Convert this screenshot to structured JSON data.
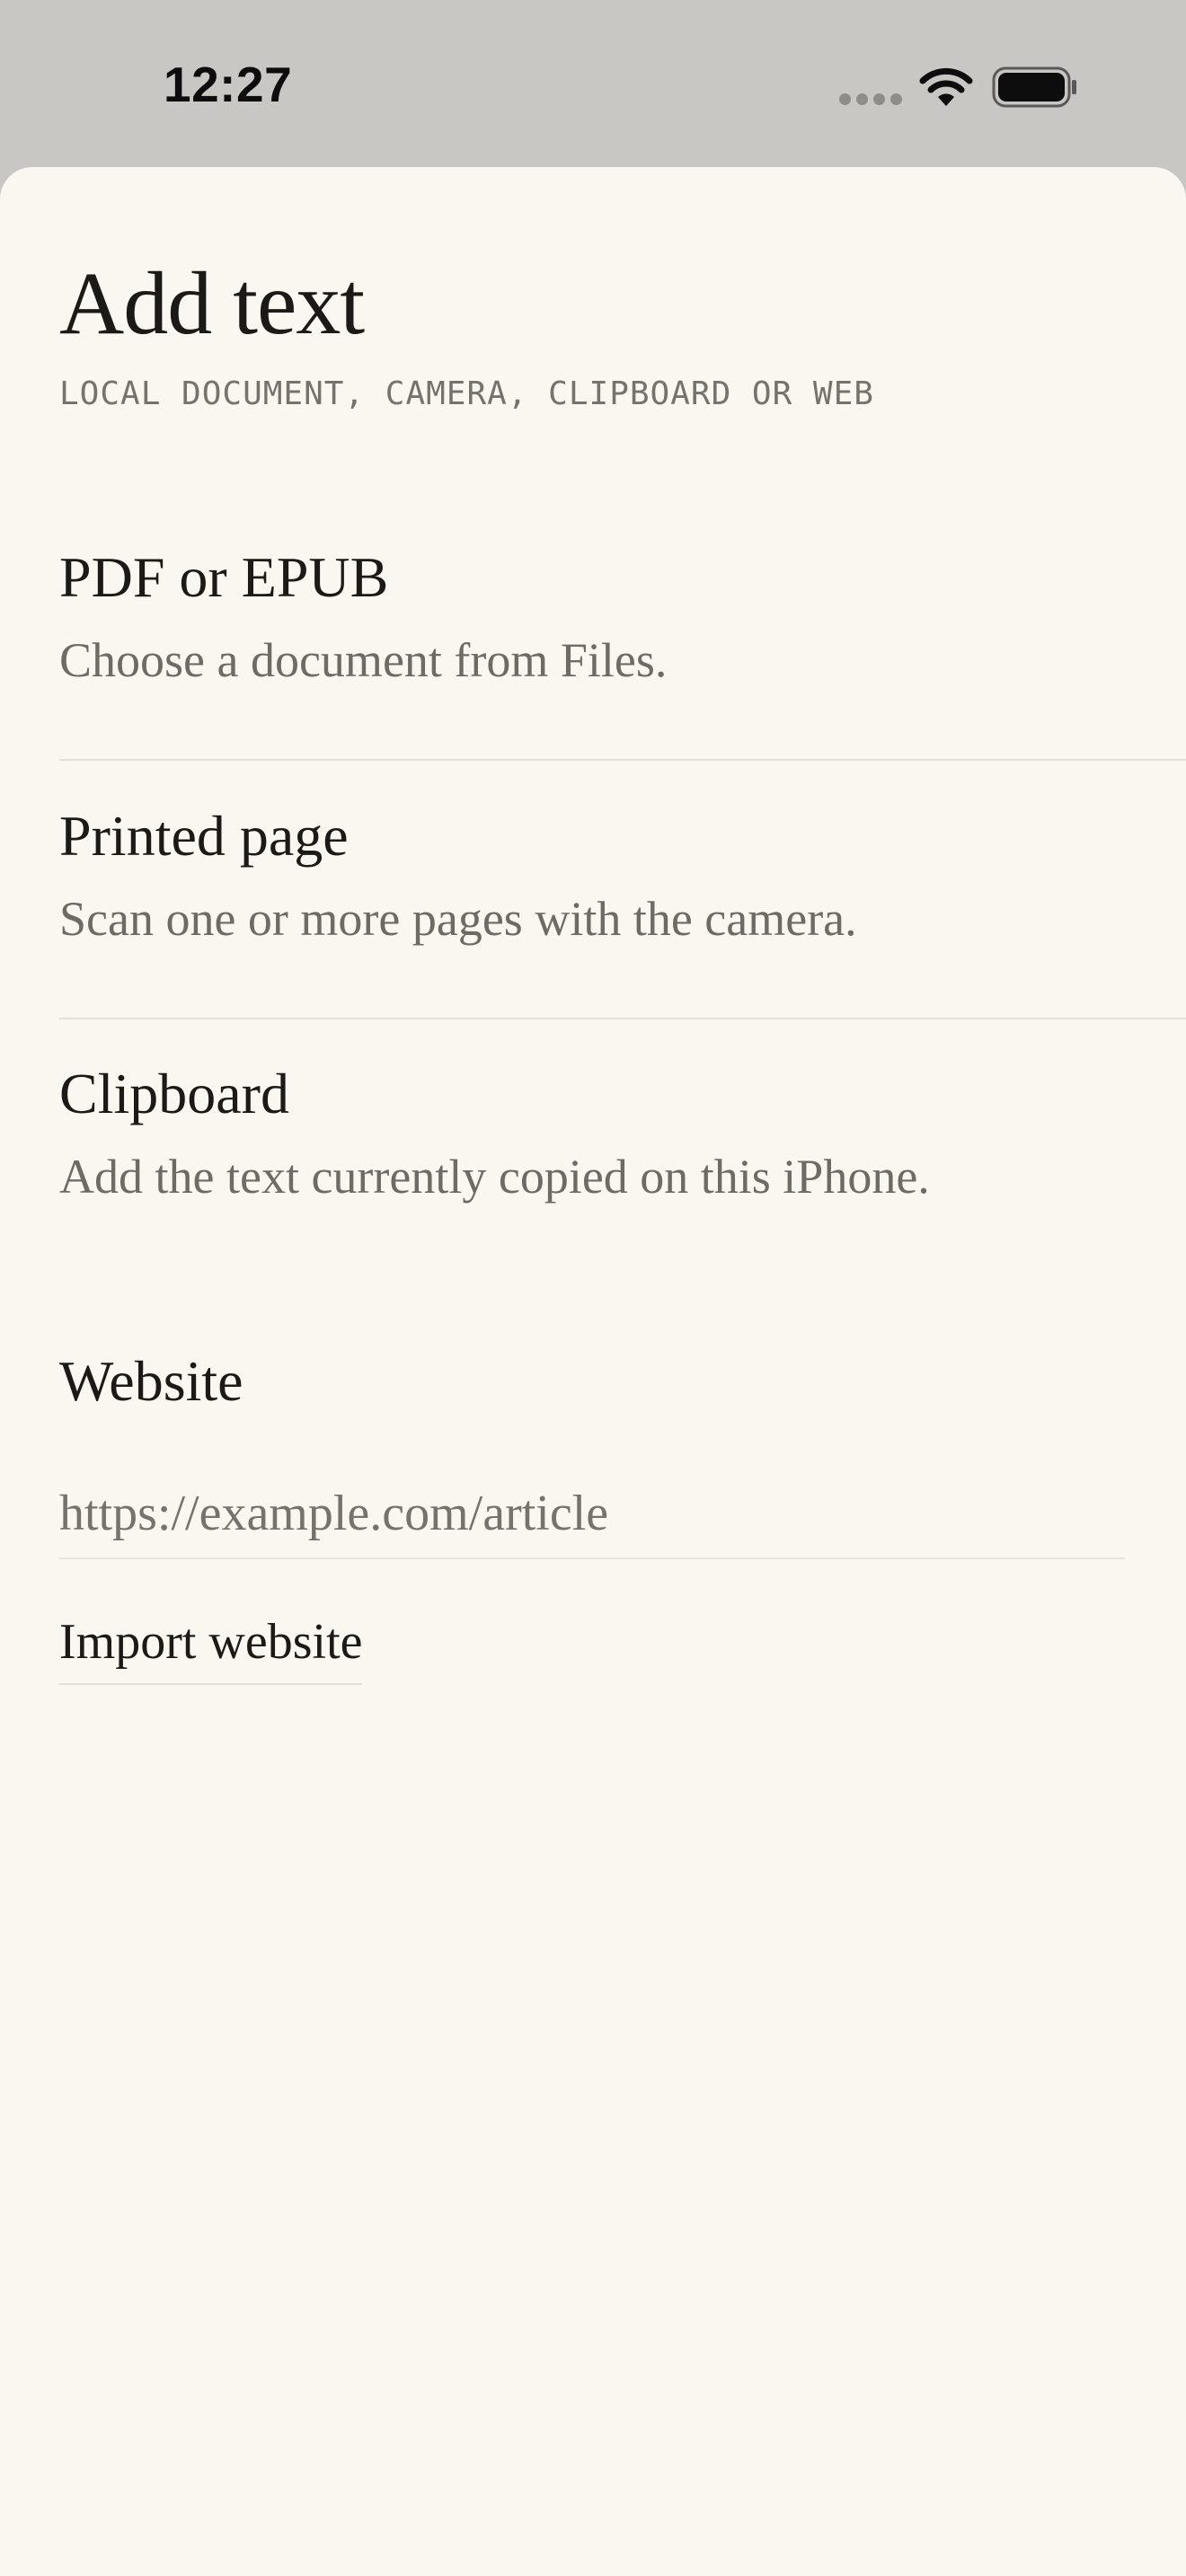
{
  "status_bar": {
    "time": "12:27"
  },
  "icons": {
    "signal": "cellular-signal-icon",
    "wifi": "wifi-icon",
    "battery": "battery-icon"
  },
  "sheet": {
    "title": "Add text",
    "subtitle": "LOCAL DOCUMENT, CAMERA, CLIPBOARD OR WEB"
  },
  "options": [
    {
      "title": "PDF or EPUB",
      "description": "Choose a document from Files."
    },
    {
      "title": "Printed page",
      "description": "Scan one or more pages with the camera."
    },
    {
      "title": "Clipboard",
      "description": "Add the text currently copied on this iPhone."
    }
  ],
  "website": {
    "label": "Website",
    "url_value": "",
    "url_placeholder": "https://example.com/article",
    "import_label": "Import website"
  },
  "colors": {
    "status_bar_background": "#c8c7c4",
    "sheet_background": "#faf7f1",
    "primary_text": "#1c1a16",
    "secondary_text": "#6f6b64"
  }
}
